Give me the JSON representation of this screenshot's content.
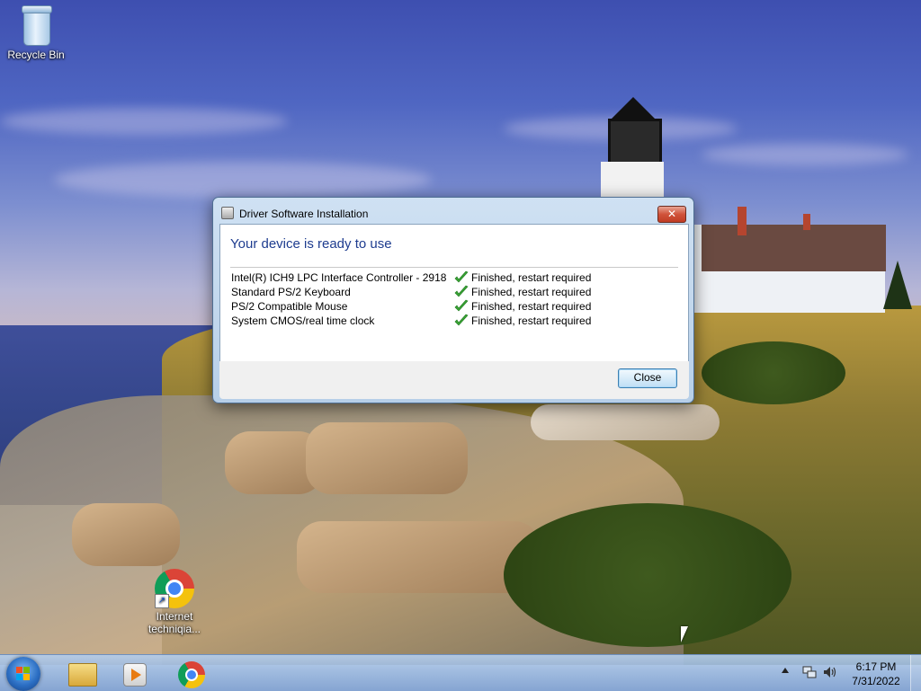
{
  "desktop": {
    "icons": [
      {
        "label": "Recycle Bin",
        "icon": "recycle-bin-icon"
      },
      {
        "label": "Internet\ntechniqia...",
        "icon": "chrome-icon"
      }
    ]
  },
  "dialog": {
    "title": "Driver Software Installation",
    "heading": "Your device is ready to use",
    "devices": [
      {
        "name": "Intel(R) ICH9 LPC Interface Controller - 2918",
        "status": "Finished, restart required"
      },
      {
        "name": "Standard PS/2 Keyboard",
        "status": "Finished, restart required"
      },
      {
        "name": "PS/2 Compatible Mouse",
        "status": "Finished, restart required"
      },
      {
        "name": "System CMOS/real time clock",
        "status": "Finished, restart required"
      }
    ],
    "close_label": "Close",
    "title_close_glyph": "✕"
  },
  "taskbar": {
    "apps": [
      {
        "name": "windows-explorer-icon"
      },
      {
        "name": "windows-media-player-icon"
      },
      {
        "name": "chrome-icon"
      }
    ],
    "clock": {
      "time": "6:17 PM",
      "date": "7/31/2022"
    }
  },
  "colors": {
    "heading": "#1e3c8f",
    "check": "#3aa335",
    "close_button": "#c03c24"
  }
}
